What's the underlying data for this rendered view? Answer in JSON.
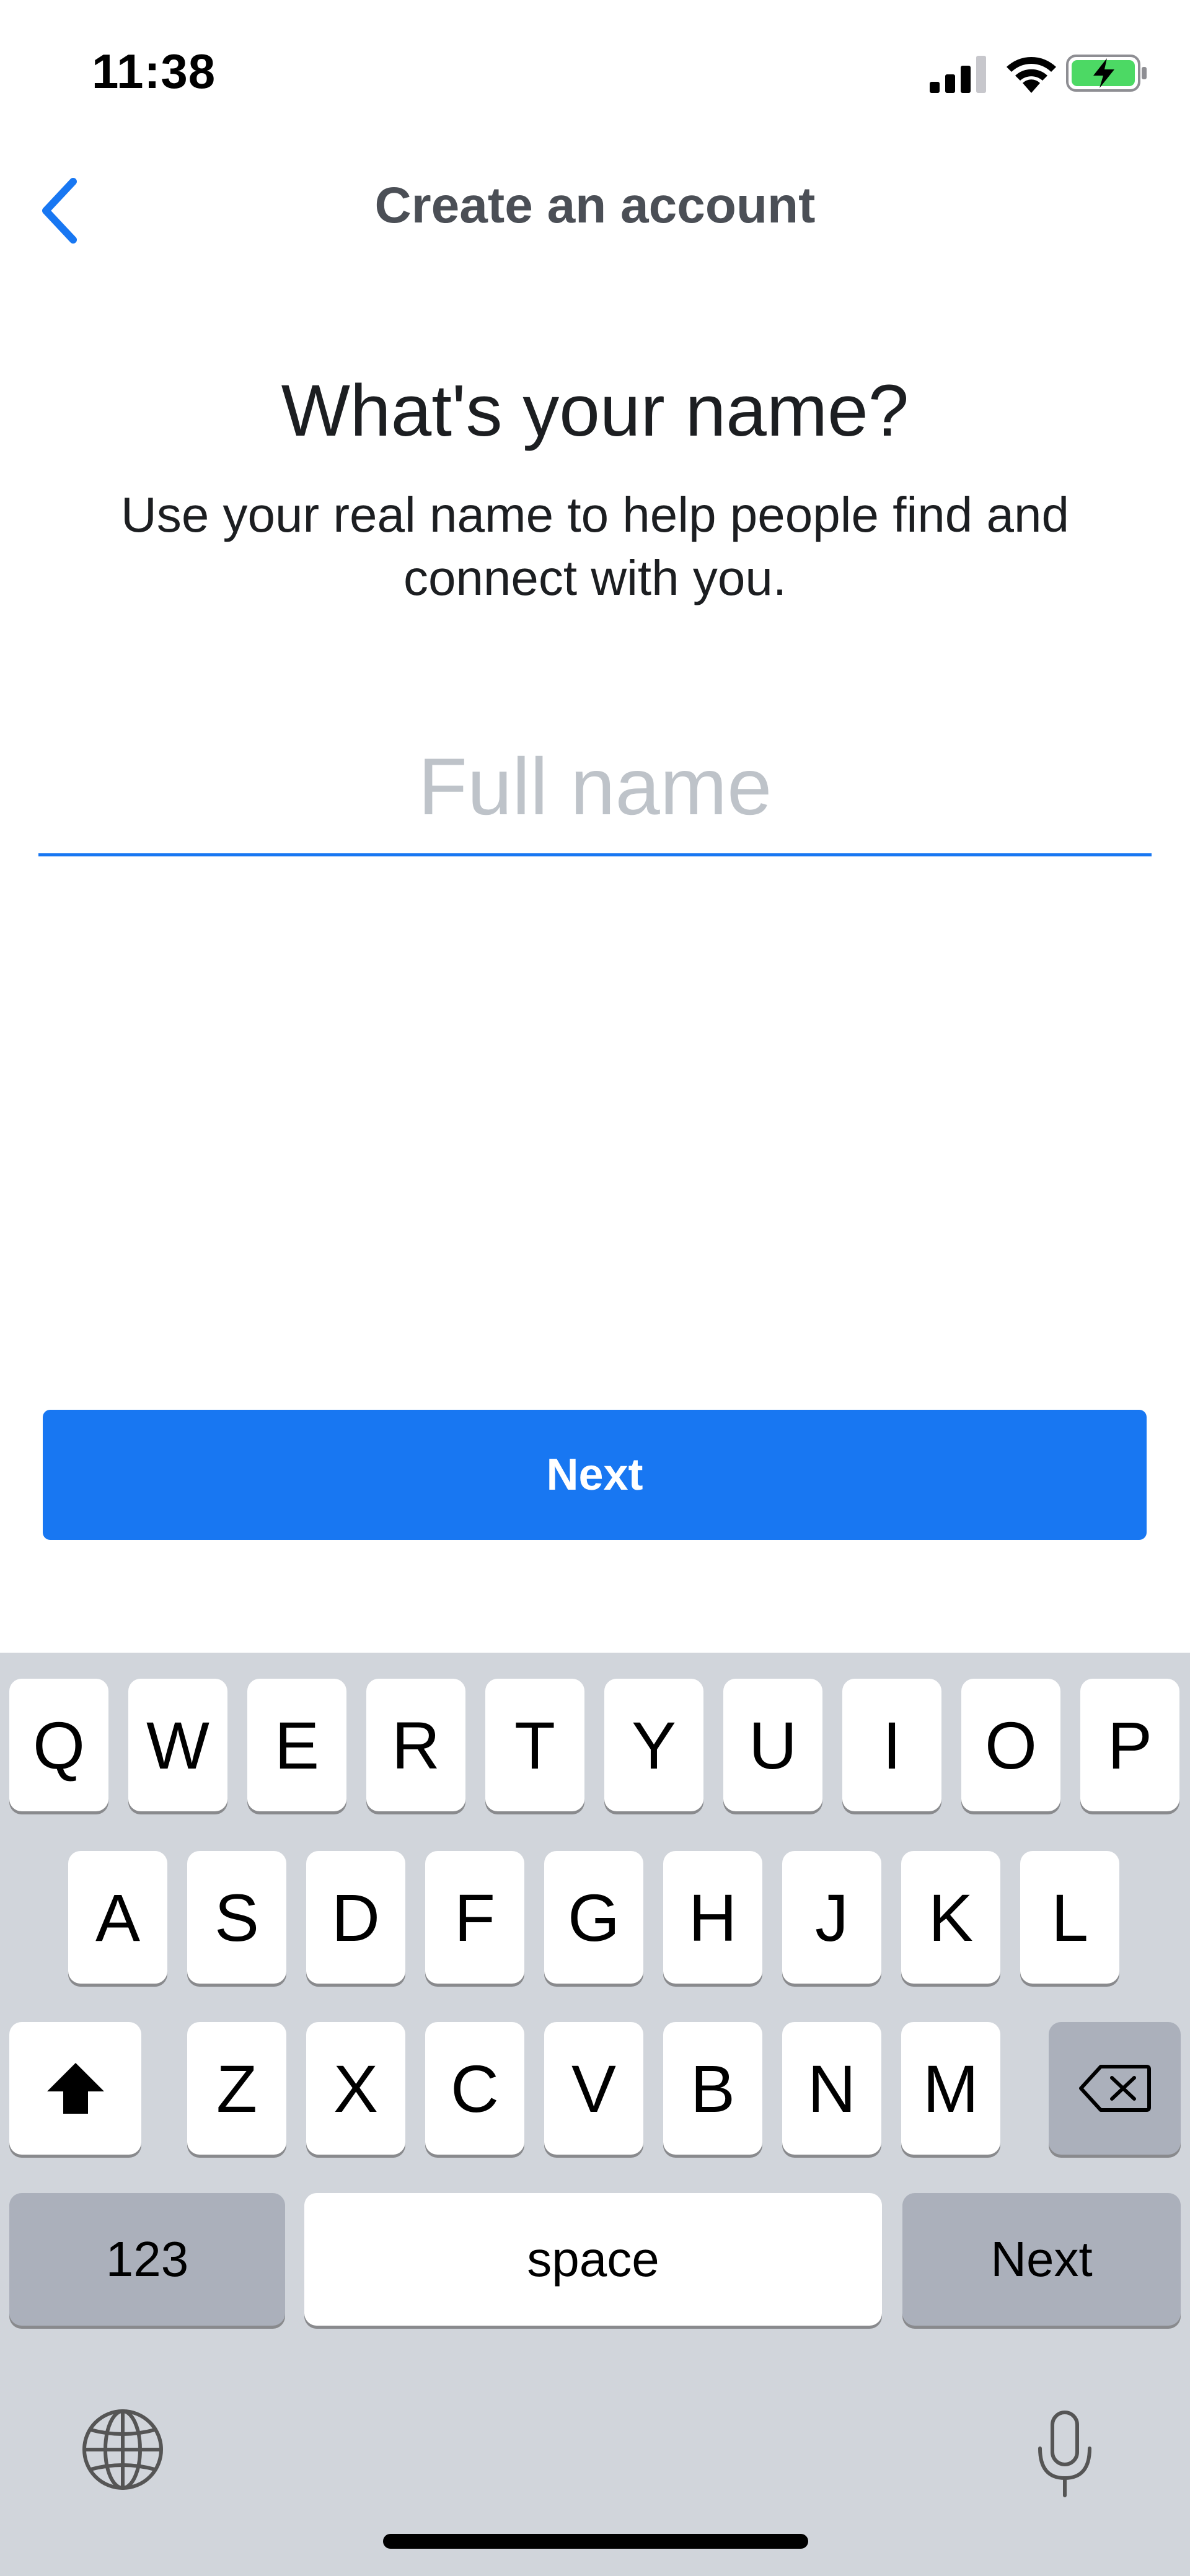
{
  "status_bar": {
    "time": "11:38"
  },
  "nav": {
    "title": "Create an account"
  },
  "content": {
    "headline": "What's your name?",
    "subtext": "Use your real name to help people find and connect with you.",
    "name_placeholder": "Full name",
    "name_value": ""
  },
  "next_button": {
    "label": "Next"
  },
  "keyboard": {
    "row1": [
      "Q",
      "W",
      "E",
      "R",
      "T",
      "Y",
      "U",
      "I",
      "O",
      "P"
    ],
    "row2": [
      "A",
      "S",
      "D",
      "F",
      "G",
      "H",
      "J",
      "K",
      "L"
    ],
    "row3": [
      "Z",
      "X",
      "C",
      "V",
      "B",
      "N",
      "M"
    ],
    "numbers_key": "123",
    "space_key": "space",
    "return_key": "Next"
  },
  "colors": {
    "accent": "#1877f2",
    "keyboard_bg": "#d1d5db",
    "battery": "#4cd964"
  },
  "icons": [
    "signal-icon",
    "wifi-icon",
    "battery-charging-icon",
    "back-chevron-icon",
    "shift-icon",
    "delete-icon",
    "globe-icon",
    "microphone-icon"
  ]
}
